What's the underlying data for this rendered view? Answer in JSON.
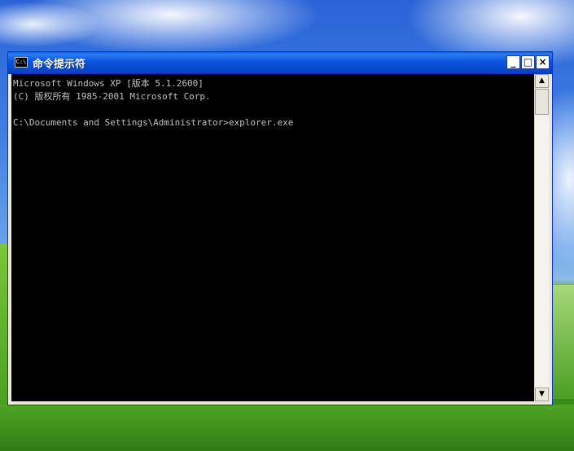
{
  "window": {
    "title": "命令提示符",
    "icon_label": "C:\\",
    "controls": {
      "minimize": "_",
      "maximize": "□",
      "close": "×"
    }
  },
  "console": {
    "lines": [
      "Microsoft Windows XP [版本 5.1.2600]",
      "(C) 版权所有 1985-2001 Microsoft Corp.",
      "",
      "C:\\Documents and Settings\\Administrator>explorer.exe"
    ]
  },
  "scrollbar": {
    "up_arrow": "▲",
    "down_arrow": "▼"
  },
  "colors": {
    "titlebar": "#0a55dd",
    "console_bg": "#000000",
    "console_fg": "#c0c0c0"
  }
}
